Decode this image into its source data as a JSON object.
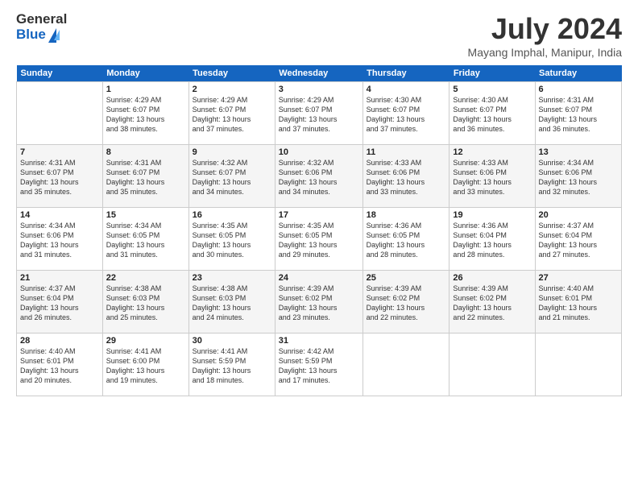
{
  "header": {
    "logo_line1": "General",
    "logo_line2": "Blue",
    "month_year": "July 2024",
    "location": "Mayang Imphal, Manipur, India"
  },
  "weekdays": [
    "Sunday",
    "Monday",
    "Tuesday",
    "Wednesday",
    "Thursday",
    "Friday",
    "Saturday"
  ],
  "weeks": [
    [
      {
        "day": "",
        "info": ""
      },
      {
        "day": "1",
        "info": "Sunrise: 4:29 AM\nSunset: 6:07 PM\nDaylight: 13 hours\nand 38 minutes."
      },
      {
        "day": "2",
        "info": "Sunrise: 4:29 AM\nSunset: 6:07 PM\nDaylight: 13 hours\nand 37 minutes."
      },
      {
        "day": "3",
        "info": "Sunrise: 4:29 AM\nSunset: 6:07 PM\nDaylight: 13 hours\nand 37 minutes."
      },
      {
        "day": "4",
        "info": "Sunrise: 4:30 AM\nSunset: 6:07 PM\nDaylight: 13 hours\nand 37 minutes."
      },
      {
        "day": "5",
        "info": "Sunrise: 4:30 AM\nSunset: 6:07 PM\nDaylight: 13 hours\nand 36 minutes."
      },
      {
        "day": "6",
        "info": "Sunrise: 4:31 AM\nSunset: 6:07 PM\nDaylight: 13 hours\nand 36 minutes."
      }
    ],
    [
      {
        "day": "7",
        "info": "Sunrise: 4:31 AM\nSunset: 6:07 PM\nDaylight: 13 hours\nand 35 minutes."
      },
      {
        "day": "8",
        "info": "Sunrise: 4:31 AM\nSunset: 6:07 PM\nDaylight: 13 hours\nand 35 minutes."
      },
      {
        "day": "9",
        "info": "Sunrise: 4:32 AM\nSunset: 6:07 PM\nDaylight: 13 hours\nand 34 minutes."
      },
      {
        "day": "10",
        "info": "Sunrise: 4:32 AM\nSunset: 6:06 PM\nDaylight: 13 hours\nand 34 minutes."
      },
      {
        "day": "11",
        "info": "Sunrise: 4:33 AM\nSunset: 6:06 PM\nDaylight: 13 hours\nand 33 minutes."
      },
      {
        "day": "12",
        "info": "Sunrise: 4:33 AM\nSunset: 6:06 PM\nDaylight: 13 hours\nand 33 minutes."
      },
      {
        "day": "13",
        "info": "Sunrise: 4:34 AM\nSunset: 6:06 PM\nDaylight: 13 hours\nand 32 minutes."
      }
    ],
    [
      {
        "day": "14",
        "info": "Sunrise: 4:34 AM\nSunset: 6:06 PM\nDaylight: 13 hours\nand 31 minutes."
      },
      {
        "day": "15",
        "info": "Sunrise: 4:34 AM\nSunset: 6:05 PM\nDaylight: 13 hours\nand 31 minutes."
      },
      {
        "day": "16",
        "info": "Sunrise: 4:35 AM\nSunset: 6:05 PM\nDaylight: 13 hours\nand 30 minutes."
      },
      {
        "day": "17",
        "info": "Sunrise: 4:35 AM\nSunset: 6:05 PM\nDaylight: 13 hours\nand 29 minutes."
      },
      {
        "day": "18",
        "info": "Sunrise: 4:36 AM\nSunset: 6:05 PM\nDaylight: 13 hours\nand 28 minutes."
      },
      {
        "day": "19",
        "info": "Sunrise: 4:36 AM\nSunset: 6:04 PM\nDaylight: 13 hours\nand 28 minutes."
      },
      {
        "day": "20",
        "info": "Sunrise: 4:37 AM\nSunset: 6:04 PM\nDaylight: 13 hours\nand 27 minutes."
      }
    ],
    [
      {
        "day": "21",
        "info": "Sunrise: 4:37 AM\nSunset: 6:04 PM\nDaylight: 13 hours\nand 26 minutes."
      },
      {
        "day": "22",
        "info": "Sunrise: 4:38 AM\nSunset: 6:03 PM\nDaylight: 13 hours\nand 25 minutes."
      },
      {
        "day": "23",
        "info": "Sunrise: 4:38 AM\nSunset: 6:03 PM\nDaylight: 13 hours\nand 24 minutes."
      },
      {
        "day": "24",
        "info": "Sunrise: 4:39 AM\nSunset: 6:02 PM\nDaylight: 13 hours\nand 23 minutes."
      },
      {
        "day": "25",
        "info": "Sunrise: 4:39 AM\nSunset: 6:02 PM\nDaylight: 13 hours\nand 22 minutes."
      },
      {
        "day": "26",
        "info": "Sunrise: 4:39 AM\nSunset: 6:02 PM\nDaylight: 13 hours\nand 22 minutes."
      },
      {
        "day": "27",
        "info": "Sunrise: 4:40 AM\nSunset: 6:01 PM\nDaylight: 13 hours\nand 21 minutes."
      }
    ],
    [
      {
        "day": "28",
        "info": "Sunrise: 4:40 AM\nSunset: 6:01 PM\nDaylight: 13 hours\nand 20 minutes."
      },
      {
        "day": "29",
        "info": "Sunrise: 4:41 AM\nSunset: 6:00 PM\nDaylight: 13 hours\nand 19 minutes."
      },
      {
        "day": "30",
        "info": "Sunrise: 4:41 AM\nSunset: 5:59 PM\nDaylight: 13 hours\nand 18 minutes."
      },
      {
        "day": "31",
        "info": "Sunrise: 4:42 AM\nSunset: 5:59 PM\nDaylight: 13 hours\nand 17 minutes."
      },
      {
        "day": "",
        "info": ""
      },
      {
        "day": "",
        "info": ""
      },
      {
        "day": "",
        "info": ""
      }
    ]
  ]
}
